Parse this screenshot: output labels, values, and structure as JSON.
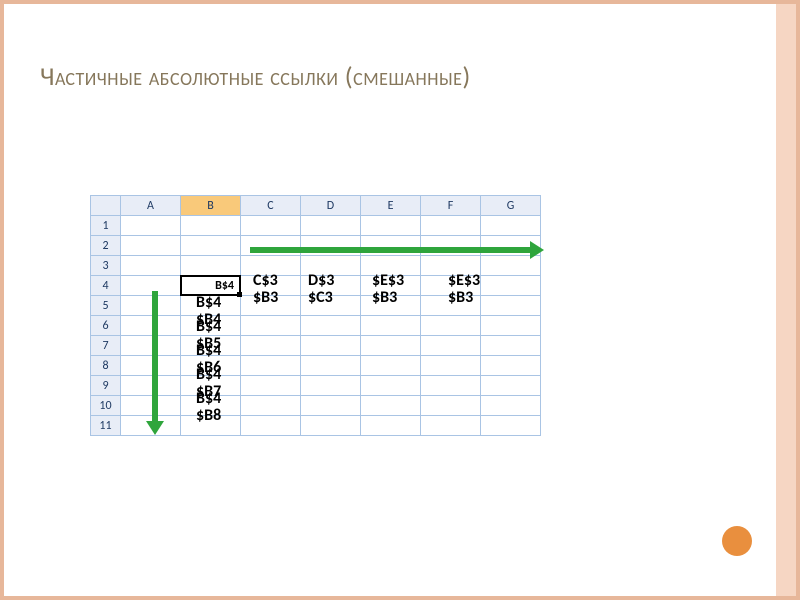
{
  "title": "Частичные абсолютные ссылки (смешанные)",
  "columns": [
    "A",
    "B",
    "C",
    "D",
    "E",
    "F",
    "G"
  ],
  "rows": [
    "1",
    "2",
    "3",
    "4",
    "5",
    "6",
    "7",
    "8",
    "9",
    "10",
    "11"
  ],
  "active_cell_value": "B$4",
  "overlay_row4": {
    "c": "C$3\n$B3",
    "d": "D$3\n$C3",
    "e": "$E$3\n$B3",
    "f": "$E$3\n$B3"
  },
  "overlay_colB": {
    "r5": "B$4\n$B4",
    "r6": "B$4\n$B5",
    "r7": "B$4\n$B6",
    "r8": "B$4\n$B7",
    "r9": "B$4\n$B8"
  },
  "colors": {
    "accent": "#e98f3e",
    "arrow": "#2fa53c"
  }
}
